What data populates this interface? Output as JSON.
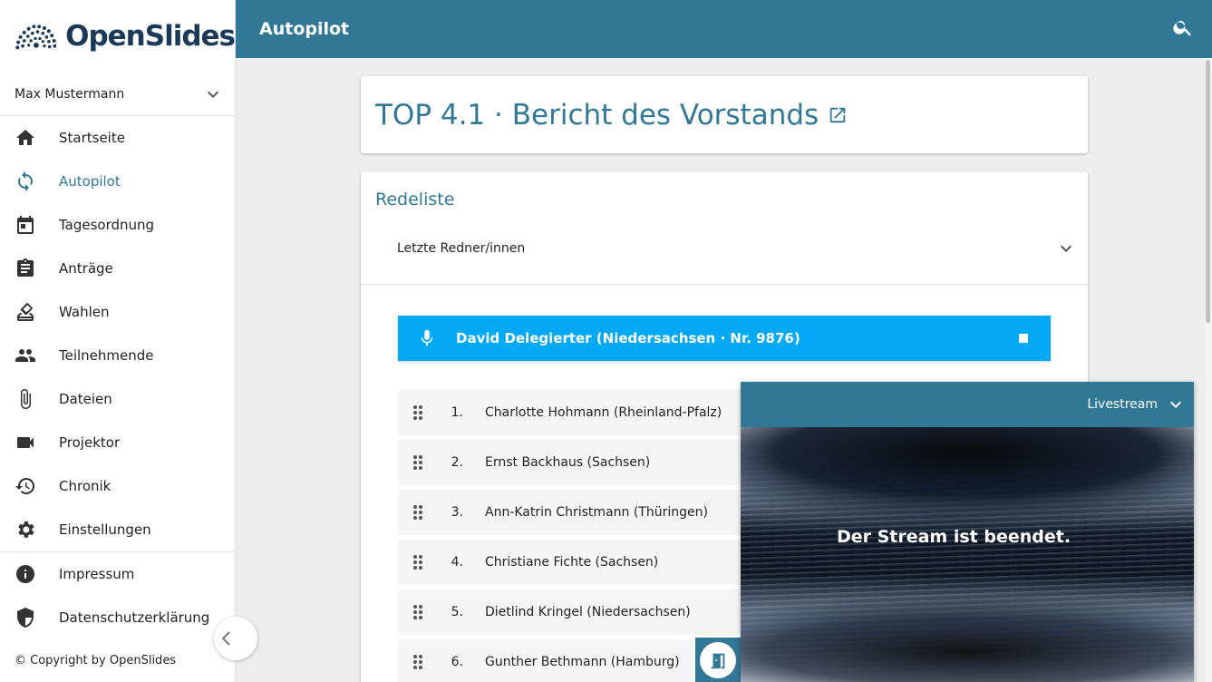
{
  "app": {
    "name": "OpenSlides"
  },
  "header": {
    "title": "Autopilot"
  },
  "user": {
    "name": "Max Mustermann"
  },
  "sidebar": {
    "items": [
      {
        "label": "Startseite",
        "icon": "home-icon"
      },
      {
        "label": "Autopilot",
        "icon": "autopilot-icon",
        "active": true
      },
      {
        "label": "Tagesordnung",
        "icon": "calendar-icon"
      },
      {
        "label": "Anträge",
        "icon": "assignment-icon"
      },
      {
        "label": "Wahlen",
        "icon": "ballot-icon"
      },
      {
        "label": "Teilnehmende",
        "icon": "people-icon"
      },
      {
        "label": "Dateien",
        "icon": "attachment-icon"
      },
      {
        "label": "Projektor",
        "icon": "videocam-icon"
      },
      {
        "label": "Chronik",
        "icon": "history-icon"
      },
      {
        "label": "Einstellungen",
        "icon": "gear-icon"
      }
    ],
    "footer_items": [
      {
        "label": "Impressum",
        "icon": "info-icon"
      },
      {
        "label": "Datenschutzerklärung",
        "icon": "shield-icon"
      }
    ],
    "copyright": "© Copyright by OpenSlides"
  },
  "agenda": {
    "title": "TOP 4.1 · Bericht des Vorstands"
  },
  "speakers": {
    "heading": "Redeliste",
    "last_speakers_label": "Letzte Redner/innen",
    "current": "David Delegierter (Niedersachsen · Nr. 9876)",
    "list": [
      {
        "num": "1.",
        "name": "Charlotte Hohmann (Rheinland-Pfalz)"
      },
      {
        "num": "2.",
        "name": "Ernst Backhaus (Sachsen)"
      },
      {
        "num": "3.",
        "name": "Ann-Katrin Christmann (Thüringen)"
      },
      {
        "num": "4.",
        "name": "Christiane Fichte (Sachsen)"
      },
      {
        "num": "5.",
        "name": "Dietlind Kringel (Niedersachsen)"
      },
      {
        "num": "6.",
        "name": "Gunther Bethmann (Hamburg)"
      }
    ]
  },
  "livestream": {
    "label": "Livestream",
    "message": "Der Stream ist beendet."
  },
  "colors": {
    "primary": "#317796",
    "accent": "#03a9f4",
    "background": "#eeeeee"
  }
}
